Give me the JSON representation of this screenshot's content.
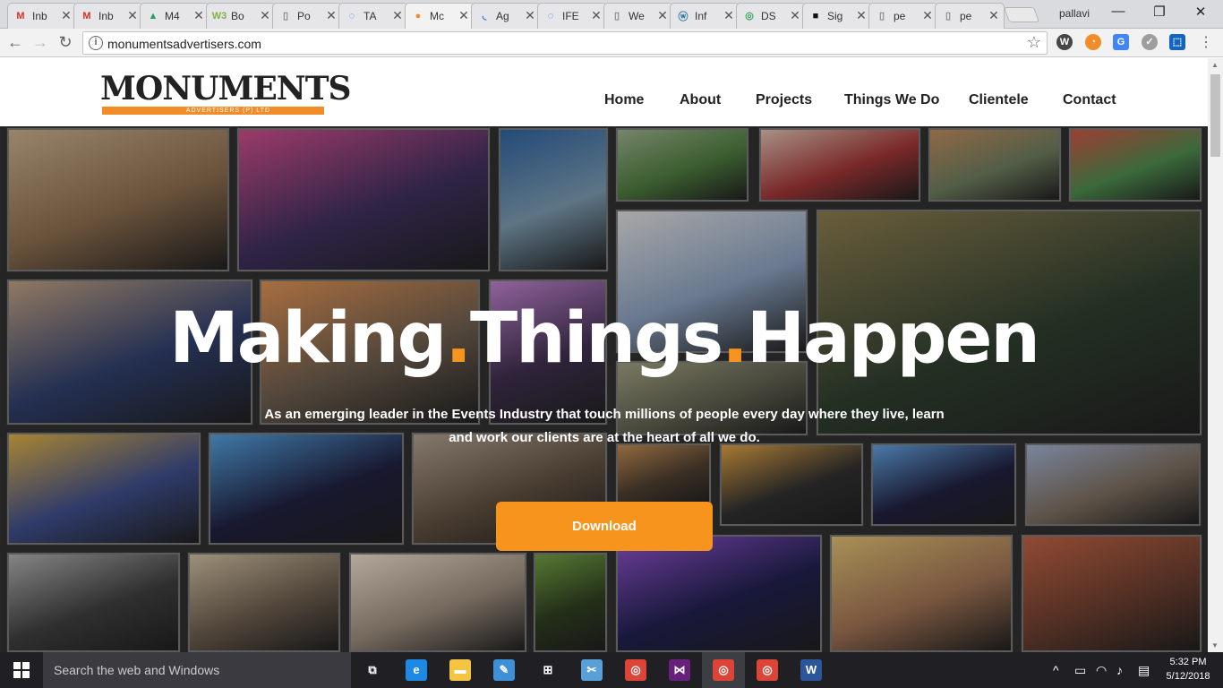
{
  "browser": {
    "tabs": [
      {
        "title": "Inb",
        "icon": "gmail-icon",
        "color": "#d93025",
        "glyph": "M"
      },
      {
        "title": "Inb",
        "icon": "gmail-icon",
        "color": "#d93025",
        "glyph": "M"
      },
      {
        "title": "M4",
        "icon": "drive-icon",
        "color": "#1fa463",
        "glyph": "▲"
      },
      {
        "title": "Bo",
        "icon": "sheet-icon",
        "color": "#7cb342",
        "glyph": "W3"
      },
      {
        "title": "Po",
        "icon": "page-icon",
        "color": "#888888",
        "glyph": "▯"
      },
      {
        "title": "TA",
        "icon": "loading-icon",
        "color": "#1a73e8",
        "glyph": "◌"
      },
      {
        "title": "Mc",
        "icon": "monuments-icon",
        "color": "#f28c28",
        "glyph": "●"
      },
      {
        "title": "Ag",
        "icon": "loading-icon",
        "color": "#1a73e8",
        "glyph": "◟"
      },
      {
        "title": "IFE",
        "icon": "loading-icon",
        "color": "#1a73e8",
        "glyph": "◌"
      },
      {
        "title": "We",
        "icon": "page-icon",
        "color": "#888888",
        "glyph": "▯"
      },
      {
        "title": "Inf",
        "icon": "wordpress-icon",
        "color": "#21759b",
        "glyph": "ⓦ"
      },
      {
        "title": "DS",
        "icon": "chrome-icon",
        "color": "#34a853",
        "glyph": "◎"
      },
      {
        "title": "Sig",
        "icon": "terminal-icon",
        "color": "#111111",
        "glyph": "■"
      },
      {
        "title": "pe",
        "icon": "page-icon",
        "color": "#888888",
        "glyph": "▯"
      },
      {
        "title": "pe",
        "icon": "page-icon",
        "color": "#888888",
        "glyph": "▯"
      }
    ],
    "active_tab_index": 6,
    "user": "pallavi",
    "url": "monumentsadvertisers.com",
    "window_controls": {
      "minimize": "—",
      "restore": "❐",
      "close": "✕"
    },
    "nav": {
      "back": "←",
      "forward": "→",
      "reload": "↻",
      "star": "☆"
    }
  },
  "site": {
    "logo_text_big": "M",
    "logo_text_rest": "ONUMENTS",
    "logo_tagline": "ADVERTISERS (P) LTD",
    "nav": [
      "Home",
      "About",
      "Projects",
      "Things We Do",
      "Clientele",
      "Contact"
    ],
    "headline_parts": [
      "Making",
      ".",
      "Things",
      ".",
      "Happen"
    ],
    "subtitle": "As an emerging leader in the Events Industry that touch millions of people every day where they live, learn and work our clients are at the heart of all we do.",
    "download_label": "Download",
    "accent_color": "#f7941d"
  },
  "taskbar": {
    "search_placeholder": "Search the web and Windows",
    "time": "5:32 PM",
    "date": "5/12/2018",
    "apps": [
      {
        "name": "task-view-icon",
        "glyph": "⧉",
        "color": "#1f1f24"
      },
      {
        "name": "edge-icon",
        "glyph": "e",
        "color": "#1e88e5"
      },
      {
        "name": "file-explorer-icon",
        "glyph": "▬",
        "color": "#f4c542"
      },
      {
        "name": "paint-icon",
        "glyph": "✎",
        "color": "#3d8fd6"
      },
      {
        "name": "store-icon",
        "glyph": "⊞",
        "color": "#1f1f24"
      },
      {
        "name": "snipping-tool-icon",
        "glyph": "✂",
        "color": "#5aa0d8"
      },
      {
        "name": "chrome-icon",
        "glyph": "◎",
        "color": "#db4437"
      },
      {
        "name": "visual-studio-icon",
        "glyph": "⋈",
        "color": "#68217a"
      },
      {
        "name": "chrome-icon",
        "glyph": "◎",
        "color": "#db4437"
      },
      {
        "name": "chrome-icon",
        "glyph": "◎",
        "color": "#db4437"
      },
      {
        "name": "word-icon",
        "glyph": "W",
        "color": "#2b579a"
      }
    ]
  }
}
